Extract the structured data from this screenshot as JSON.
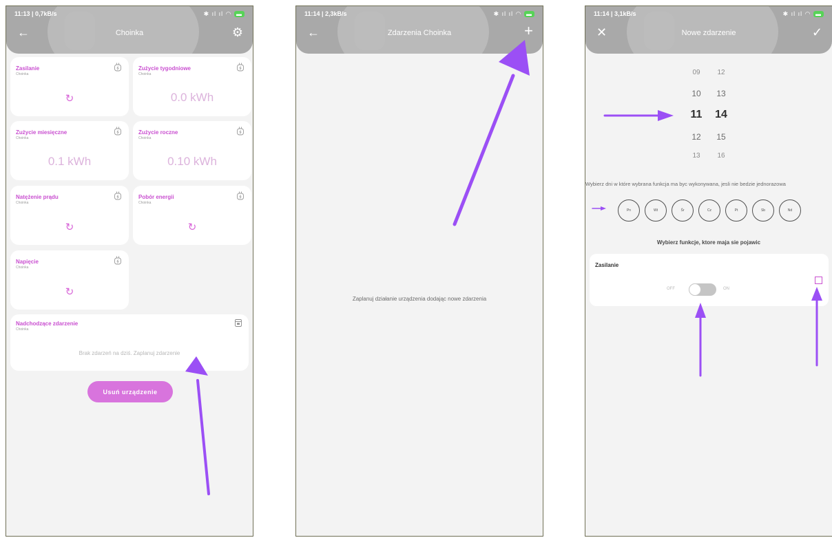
{
  "colors": {
    "accent": "#c94fd0",
    "arrow": "#9b4ff5",
    "header": "#a9a9a9",
    "background": "#f3f3f3"
  },
  "phone1": {
    "status_left": "11:13 | 0,7kB/s",
    "header": {
      "back_icon": "arrow-left-icon",
      "title": "Choinka",
      "settings_icon": "gear-icon"
    },
    "tiles": [
      {
        "title": "Zasilanie",
        "subtitle": "Choinka",
        "value": "",
        "icon": "plug-icon"
      },
      {
        "title": "Zużycie tygodniowe",
        "subtitle": "Choinka",
        "value": "0.0 kWh",
        "icon": "plug-icon"
      },
      {
        "title": "Zużycie miesięczne",
        "subtitle": "Choinka",
        "value": "0.1 kWh",
        "icon": "plug-icon"
      },
      {
        "title": "Zużycie roczne",
        "subtitle": "Choinka",
        "value": "0.10 kWh",
        "icon": "plug-icon"
      },
      {
        "title": "Natężenie prądu",
        "subtitle": "Choinka",
        "value": "",
        "icon": "plug-icon"
      },
      {
        "title": "Pobór energii",
        "subtitle": "Choinka",
        "value": "",
        "icon": "plug-icon"
      },
      {
        "title": "Napięcie",
        "subtitle": "Choinka",
        "value": "",
        "icon": "plug-icon"
      }
    ],
    "refresh_glyph": "↻",
    "upcoming": {
      "title": "Nadchodzące zdarzenie",
      "subtitle": "Choinka",
      "message": "Brak zdarzeń na dziś. Zaplanuj zdarzenie",
      "icon": "calendar-icon"
    },
    "delete_button": "Usuń urządzenie"
  },
  "phone2": {
    "status_left": "11:14 | 2,3kB/s",
    "header": {
      "back_icon": "arrow-left-icon",
      "title": "Zdarzenia Choinka",
      "add_icon": "plus-icon"
    },
    "empty_message": "Zaplanuj działanie urządzenia dodając nowe zdarzenia"
  },
  "phone3": {
    "status_left": "11:14 | 3,1kB/s",
    "header": {
      "close_icon": "close-icon",
      "title": "Nowe zdarzenie",
      "confirm_icon": "check-icon"
    },
    "picker": {
      "rows": [
        [
          "09",
          "12"
        ],
        [
          "10",
          "13"
        ],
        [
          "11",
          "14"
        ],
        [
          "12",
          "15"
        ],
        [
          "13",
          "16"
        ]
      ],
      "selected_hour": "11",
      "selected_minute": "14"
    },
    "days_label": "Wybierz dni w które wybrana funkcja ma byc wykonywana, jesli nie bedzie jednorazowa",
    "days": [
      "Pn",
      "Wt",
      "Śr",
      "Cz",
      "Pt",
      "Sb",
      "Nd"
    ],
    "functions_label": "Wybierz funkcje, ktore maja sie pojawic",
    "function_card": {
      "title": "Zasilanie",
      "off_label": "OFF",
      "on_label": "ON",
      "toggle_on": false,
      "checked": false
    }
  }
}
